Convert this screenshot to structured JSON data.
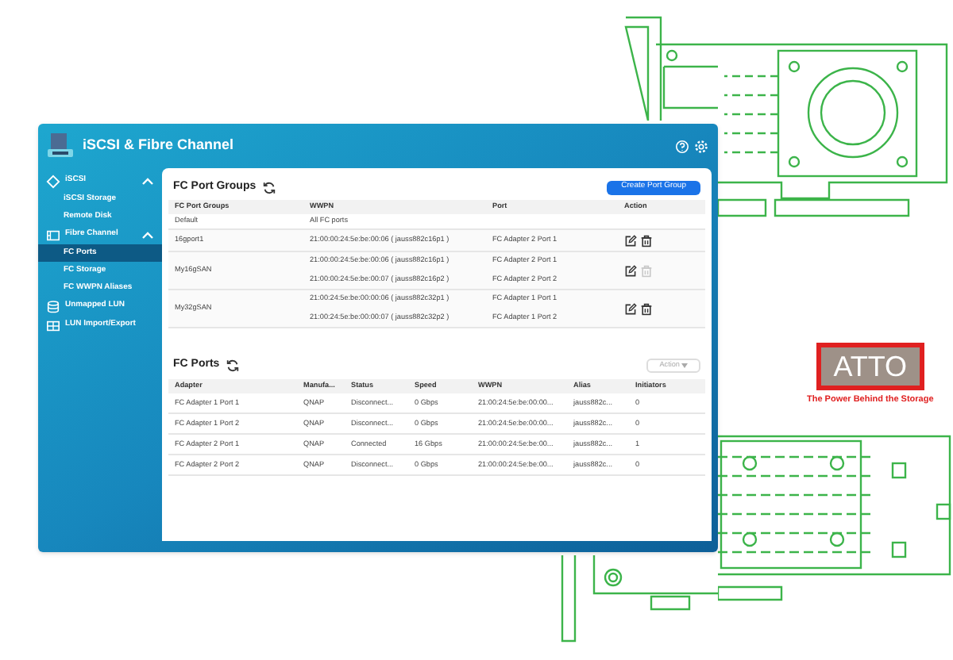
{
  "window": {
    "title": "iSCSI & Fibre Channel"
  },
  "sidebar": {
    "items": [
      {
        "label": "iSCSI",
        "kind": "iscsi",
        "expanded": true,
        "children": [
          {
            "label": "iSCSI Storage",
            "selected": false
          },
          {
            "label": "Remote Disk",
            "selected": false
          }
        ]
      },
      {
        "label": "Fibre Channel",
        "kind": "fibre",
        "expanded": true,
        "children": [
          {
            "label": "FC Ports",
            "selected": true
          },
          {
            "label": "FC Storage",
            "selected": false
          },
          {
            "label": "FC WWPN Aliases",
            "selected": false
          }
        ]
      },
      {
        "label": "Unmapped LUN",
        "kind": "database"
      },
      {
        "label": "LUN Import/Export",
        "kind": "transfer"
      }
    ]
  },
  "port_groups": {
    "title": "FC Port Groups",
    "create_button": "Create Port Group",
    "columns": [
      "FC Port Groups",
      "WWPN",
      "Port",
      "Action"
    ],
    "rows": [
      {
        "name": "Default",
        "editable": false,
        "entries": [
          {
            "wwpn": "All FC ports"
          }
        ]
      },
      {
        "name": "16gport1",
        "editable": true,
        "delete_disabled": false,
        "entries": [
          {
            "wwpn": "21:00:00:24:5e:be:00:06 ( jauss882c16p1 )",
            "port": "FC Adapter 2 Port 1"
          }
        ]
      },
      {
        "name": "My16gSAN",
        "editable": true,
        "delete_disabled": true,
        "entries": [
          {
            "wwpn": "21:00:00:24:5e:be:00:06 ( jauss882c16p1 )",
            "port": "FC Adapter 2 Port 1"
          },
          {
            "wwpn": "21:00:00:24:5e:be:00:07 ( jauss882c16p2 )",
            "port": "FC Adapter 2 Port 2"
          }
        ]
      },
      {
        "name": "My32gSAN",
        "editable": true,
        "delete_disabled": false,
        "entries": [
          {
            "wwpn": "21:00:24:5e:be:00:00:06 ( jauss882c32p1 )",
            "port": "FC Adapter 1 Port 1"
          },
          {
            "wwpn": "21:00:24:5e:be:00:00:07 ( jauss882c32p2 )",
            "port": "FC Adapter 1 Port 2"
          }
        ]
      }
    ]
  },
  "ports": {
    "title": "FC Ports",
    "action_button": {
      "label": "Action",
      "disabled": true
    },
    "columns": [
      "Adapter",
      "Manufa...",
      "Status",
      "Speed",
      "WWPN",
      "Alias",
      "Initiators"
    ],
    "rows": [
      [
        "FC Adapter 1 Port 1",
        "QNAP",
        "Disconnect...",
        "0 Gbps",
        "21:00:24:5e:be:00:00...",
        "jauss882c...",
        "0"
      ],
      [
        "FC Adapter 1 Port 2",
        "QNAP",
        "Disconnect...",
        "0 Gbps",
        "21:00:24:5e:be:00:00...",
        "jauss882c...",
        "0"
      ],
      [
        "FC Adapter 2 Port 1",
        "QNAP",
        "Connected",
        "16 Gbps",
        "21:00:00:24:5e:be:00...",
        "jauss882c...",
        "1"
      ],
      [
        "FC Adapter 2 Port 2",
        "QNAP",
        "Disconnect...",
        "0 Gbps",
        "21:00:00:24:5e:be:00...",
        "jauss882c...",
        "0"
      ]
    ]
  },
  "logo": {
    "text": "ATTO",
    "tagline": "The Power Behind the Storage"
  }
}
